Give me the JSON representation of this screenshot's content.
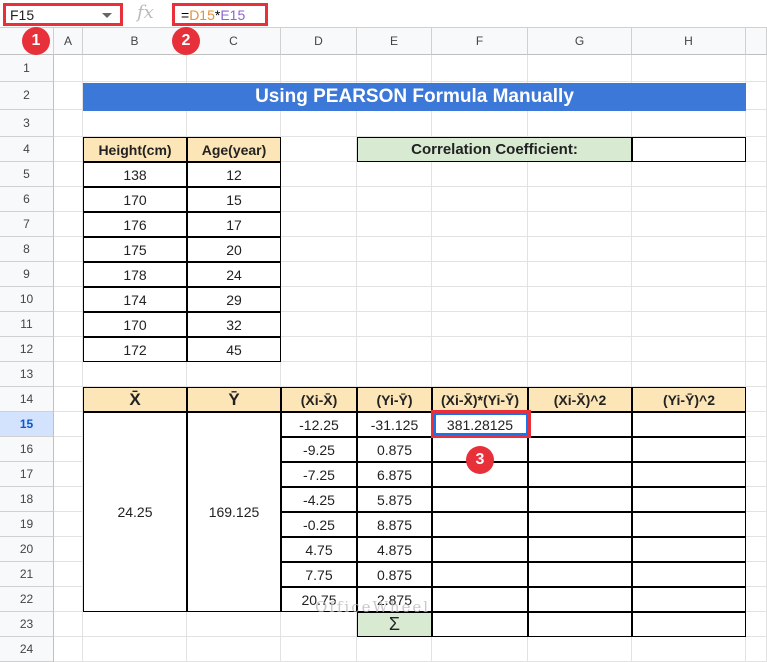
{
  "formula_bar": {
    "cell_ref": "F15",
    "fx": "fx",
    "formula_eq": "=",
    "formula_ref1": "D15",
    "formula_op": "*",
    "formula_ref2": "E15"
  },
  "columns": [
    "A",
    "B",
    "C",
    "D",
    "E",
    "F",
    "G",
    "H"
  ],
  "rows": [
    "1",
    "2",
    "3",
    "4",
    "5",
    "6",
    "7",
    "8",
    "9",
    "10",
    "11",
    "12",
    "13",
    "14",
    "15",
    "16",
    "17",
    "18",
    "19",
    "20",
    "21",
    "22",
    "23",
    "24"
  ],
  "selected_row": "15",
  "title": "Using PEARSON Formula Manually",
  "colors": {
    "title_bg": "#3c78d8",
    "header_bg": "#fce5b6",
    "label_bg": "#d9ead3",
    "accent": "#e8303a"
  },
  "data_table": {
    "headers": [
      "Height(cm)",
      "Age(year)"
    ],
    "rows": [
      [
        "138",
        "12"
      ],
      [
        "170",
        "15"
      ],
      [
        "176",
        "17"
      ],
      [
        "175",
        "20"
      ],
      [
        "178",
        "24"
      ],
      [
        "174",
        "29"
      ],
      [
        "170",
        "32"
      ],
      [
        "172",
        "45"
      ]
    ]
  },
  "correlation": {
    "label": "Correlation Coefficient:",
    "value": ""
  },
  "calc_table": {
    "headers": [
      "X̄",
      "Ȳ",
      "(Xi-X̄)",
      "(Yi-Ȳ)",
      "(Xi-X̄)*(Yi-Ȳ)",
      "(Xi-X̄)^2",
      "(Yi-Ȳ)^2"
    ],
    "x_mean": "24.25",
    "y_mean": "169.125",
    "rows": [
      [
        "-12.25",
        "-31.125",
        "381.28125",
        "",
        ""
      ],
      [
        "-9.25",
        "0.875",
        "",
        "",
        ""
      ],
      [
        "-7.25",
        "6.875",
        "",
        "",
        ""
      ],
      [
        "-4.25",
        "5.875",
        "",
        "",
        ""
      ],
      [
        "-0.25",
        "8.875",
        "",
        "",
        ""
      ],
      [
        "4.75",
        "4.875",
        "",
        "",
        ""
      ],
      [
        "7.75",
        "0.875",
        "",
        "",
        ""
      ],
      [
        "20.75",
        "2.875",
        "",
        "",
        ""
      ]
    ],
    "sum_label": "Σ"
  },
  "badges": [
    "1",
    "2",
    "3"
  ],
  "watermark": "OfficeWheel"
}
